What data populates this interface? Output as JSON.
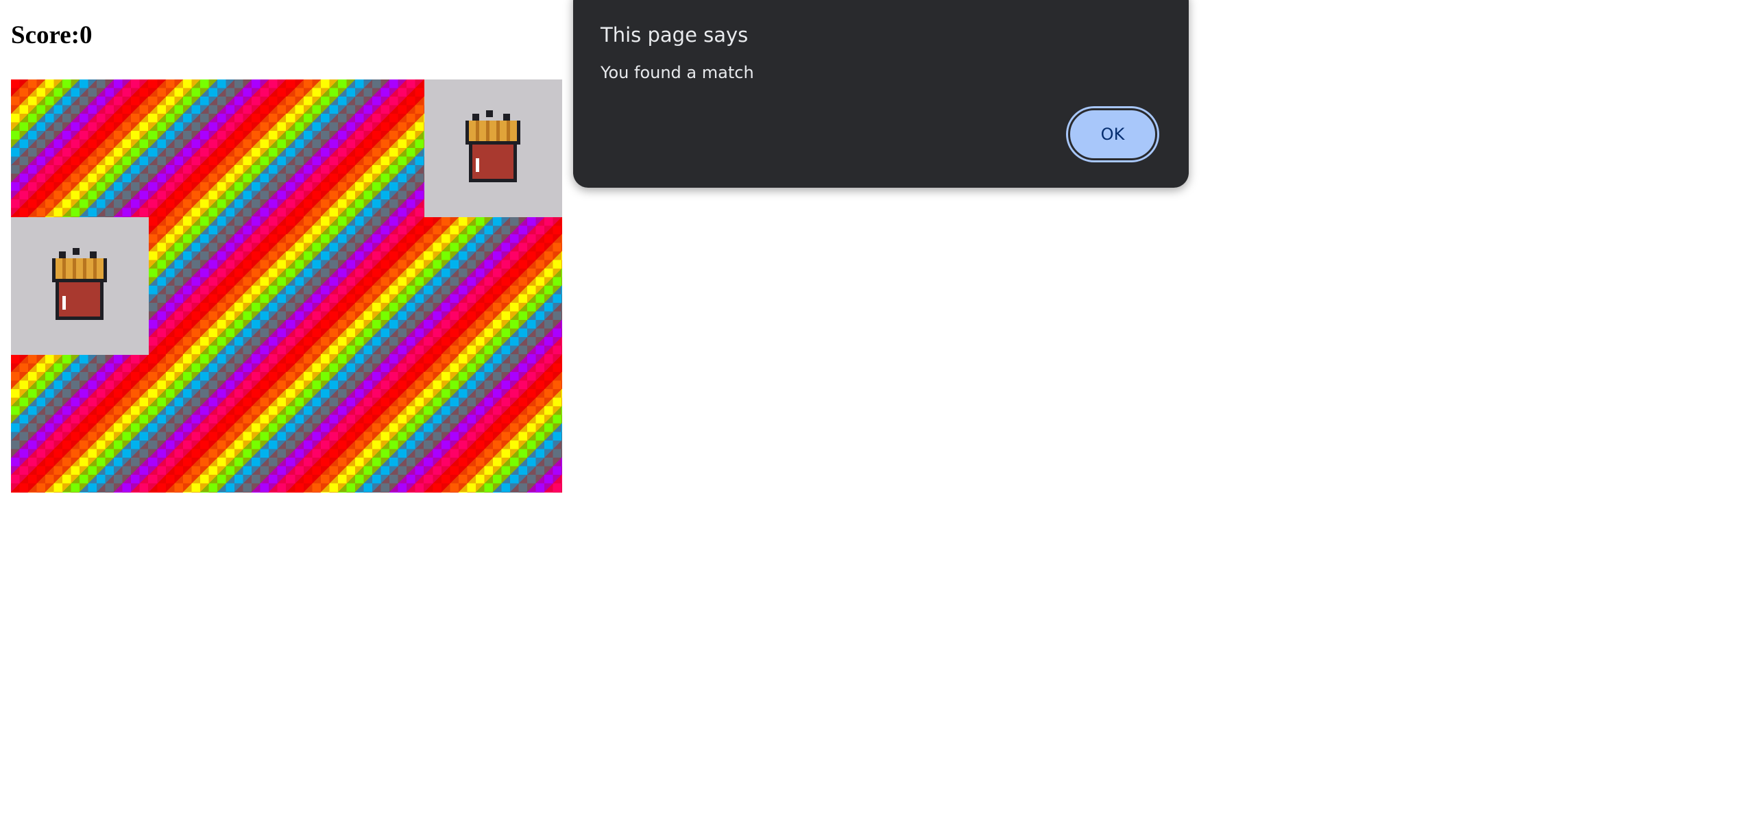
{
  "score": {
    "text": "Score:0"
  },
  "board": {
    "rows": 3,
    "columns": 4,
    "tiles": [
      {
        "state": "hidden"
      },
      {
        "state": "hidden"
      },
      {
        "state": "hidden"
      },
      {
        "state": "revealed",
        "icon": "french-fries-icon"
      },
      {
        "state": "revealed",
        "icon": "french-fries-icon"
      },
      {
        "state": "hidden"
      },
      {
        "state": "hidden"
      },
      {
        "state": "hidden"
      },
      {
        "state": "hidden"
      },
      {
        "state": "hidden"
      },
      {
        "state": "hidden"
      },
      {
        "state": "hidden"
      }
    ]
  },
  "dialog": {
    "title": "This page says",
    "message": "You found a match",
    "ok_label": "OK"
  },
  "colors": {
    "dialog_bg": "#292a2d",
    "ok_button": "#a8c7fa",
    "revealed_tile": "#c9c7cb"
  }
}
